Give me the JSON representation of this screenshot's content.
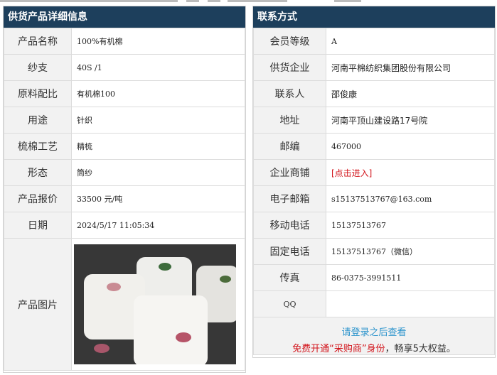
{
  "left_panel": {
    "title": "供货产品详细信息",
    "rows": [
      {
        "label": "产品名称",
        "value": "100%有机棉"
      },
      {
        "label": "纱支",
        "value": "40S /1"
      },
      {
        "label": "原料配比",
        "value": "有机棉100"
      },
      {
        "label": "用途",
        "value": "针织"
      },
      {
        "label": "梳棉工艺",
        "value": "精梳"
      },
      {
        "label": "形态",
        "value": "筒纱"
      },
      {
        "label": "产品报价",
        "value": "33500 元/吨"
      },
      {
        "label": "日期",
        "value": "2024/5/17 11:05:34"
      }
    ],
    "image_label": "产品图片"
  },
  "right_panel": {
    "title": "联系方式",
    "rows": [
      {
        "label": "会员等级",
        "value": "A"
      },
      {
        "label": "供货企业",
        "value": "河南平棉纺织集团股份有限公司"
      },
      {
        "label": "联系人",
        "value": "邵俊康"
      },
      {
        "label": "地址",
        "value": "河南平顶山建设路17号院"
      },
      {
        "label": "邮编",
        "value": "467000"
      },
      {
        "label": "企业商铺",
        "value": "[点击进入]"
      },
      {
        "label": "电子邮箱",
        "value": "s15137513767@163.com"
      },
      {
        "label": "移动电话",
        "value": "15137513767"
      },
      {
        "label": "固定电话",
        "value": "15137513767（微信）"
      },
      {
        "label": "传真",
        "value": "86-0375-3991511"
      },
      {
        "label": "QQ",
        "value": ""
      }
    ],
    "login_text": "请登录之后查看",
    "promo_prefix": "免费开通“采购商”身份",
    "promo_suffix": "，畅享5大权益。"
  },
  "colors": {
    "header_bg": "#1d3f5c",
    "label_bg": "#f2f2f2",
    "login_link": "#2a93cc",
    "promo_red": "#d2131a"
  }
}
